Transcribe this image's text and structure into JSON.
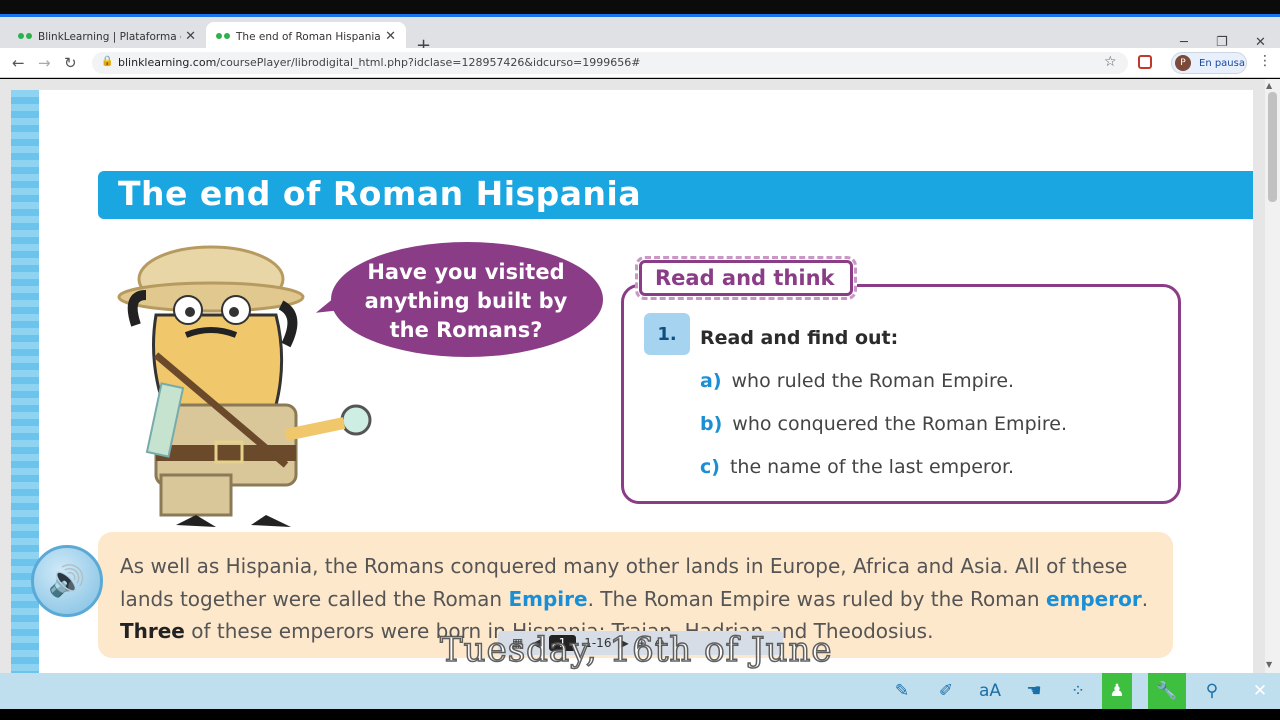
{
  "browser": {
    "tabs": [
      {
        "title": "BlinkLearning | Plataforma educ",
        "active": false
      },
      {
        "title": "The end of Roman Hispania | Bli",
        "active": true
      }
    ],
    "url_host": "blinklearning.com",
    "url_path": "/coursePlayer/librodigital_html.php?idclase=128957426&idcurso=1999656#",
    "profile_initial": "P",
    "profile_status": "En pausa"
  },
  "lesson": {
    "title": "The end of Roman Hispania",
    "bubble_text": "Have you visited anything built by the Romans?",
    "read_think_label": "Read and think",
    "question_number": "1.",
    "question_heading": "Read and find out:",
    "questions": [
      {
        "letter": "a)",
        "text": "who ruled the Roman Empire."
      },
      {
        "letter": "b)",
        "text": "who conquered the Roman Empire."
      },
      {
        "letter": "c)",
        "text": "the name of the last emperor."
      }
    ],
    "paragraph": {
      "p1": "As well as Hispania, the Romans conquered many other lands in Europe, Africa and Asia. All of these lands together were called the Roman ",
      "kw1": "Empire",
      "p2": ". The Roman Empire was ruled by the Roman ",
      "kw2": "emperor",
      "p3": ". ",
      "strong": "Three",
      "p4": " of these emperors were born in Hispania: Trajan, Hadrian and Theodosius."
    }
  },
  "pager": {
    "page": "1",
    "total": "1-16"
  },
  "caption": "Tuesday, 16th of June",
  "colors": {
    "accent": "#1aa6e0",
    "purple": "#8a3d86",
    "keyword": "#1a8fd6",
    "text_bg": "#fde8cc"
  }
}
